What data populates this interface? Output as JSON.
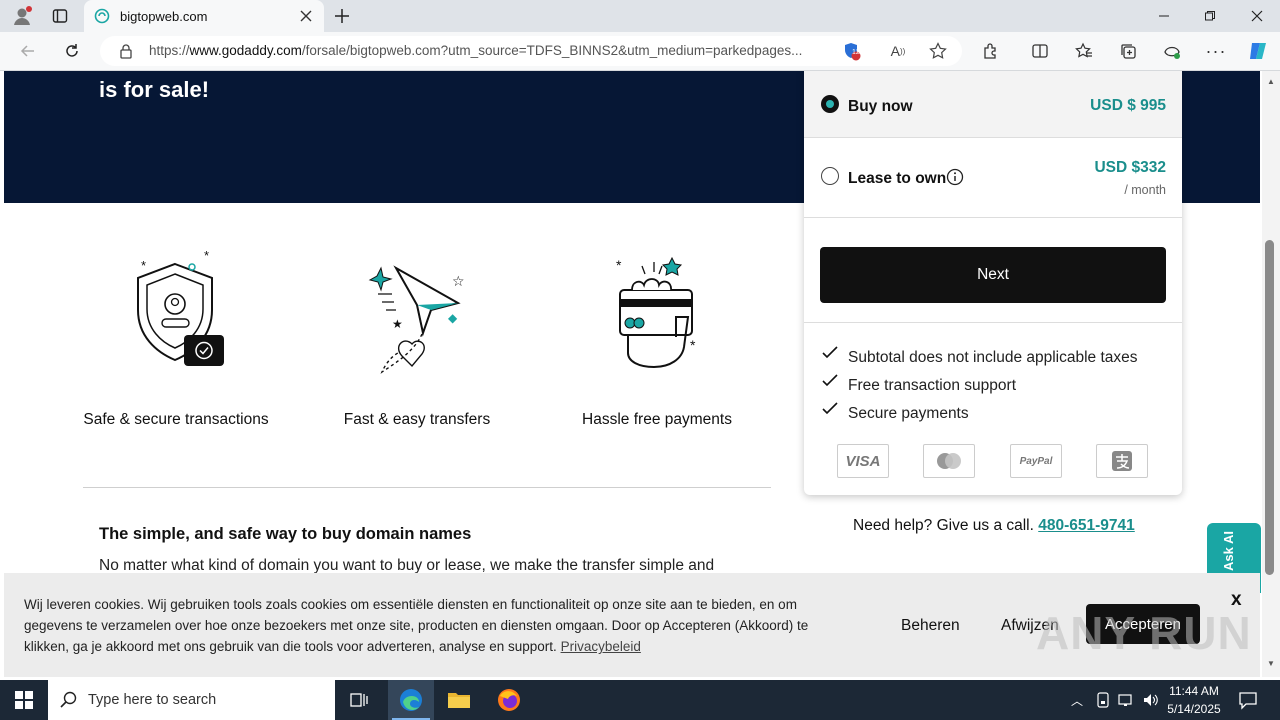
{
  "browser": {
    "tab_title": "bigtopweb.com",
    "url_prefix": "https://",
    "url_domain": "www.godaddy.com",
    "url_rest": "/forsale/bigtopweb.com?utm_source=TDFS_BINNS2&utm_medium=parkedpages...",
    "extension_badge": "12"
  },
  "hero": {
    "text": "is for sale!"
  },
  "features": [
    {
      "label": "Safe & secure transactions"
    },
    {
      "label": "Fast & easy transfers"
    },
    {
      "label": "Hassle free payments"
    }
  ],
  "section": {
    "title": "The simple, and safe way to buy domain names",
    "text": "No matter what kind of domain you want to buy or lease, we make the transfer simple and"
  },
  "purchase": {
    "buy_now_label": "Buy now",
    "buy_now_price": "USD $ 995",
    "lease_label": "Lease to own",
    "lease_price": "USD $332",
    "lease_period": "/ month",
    "next_label": "Next",
    "checks": [
      "Subtotal does not include applicable taxes",
      "Free transaction support",
      "Secure payments"
    ],
    "payment_methods": [
      "VISA",
      "Mastercard",
      "PayPal",
      "Alipay"
    ]
  },
  "help": {
    "text": "Need help? Give us a call.",
    "phone": "480-651-9741"
  },
  "ask_ai": {
    "label": "Ask AI"
  },
  "cookie": {
    "text": "Wij leveren cookies. Wij gebruiken tools zoals cookies om essentiële diensten en functionaliteit op onze site aan te bieden, en om gegevens te verzamelen over hoe onze bezoekers met onze site, producten en diensten omgaan. Door op Accepteren (Akkoord) te klikken, ga je akkoord met ons gebruik van die tools voor adverteren, analyse en support.",
    "link": "Privacybeleid",
    "manage": "Beheren",
    "reject": "Afwijzen",
    "accept": "Accepteren",
    "close": "x"
  },
  "watermark": "ANY RUN",
  "taskbar": {
    "search_placeholder": "Type here to search",
    "time": "11:44 AM",
    "date": "5/14/2025"
  },
  "colors": {
    "hero": "#061735",
    "accent": "#1a8e8c",
    "button": "#111111"
  }
}
